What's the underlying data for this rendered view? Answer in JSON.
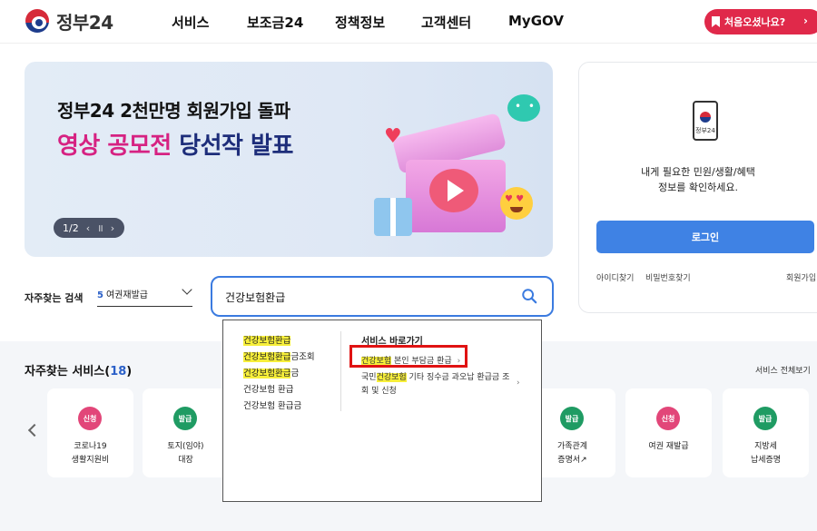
{
  "header": {
    "logo_text": "정부24",
    "nav": [
      "서비스",
      "보조금24",
      "정책정보",
      "고객센터",
      "MyGOV"
    ],
    "cta_label": "처음오셨나요?",
    "cta_arrow": "›"
  },
  "banner": {
    "line1": "정부24  2천만명 회원가입 돌파",
    "line2_pink": "영상 공모전",
    "line2_navy": "당선작 발표",
    "pager_text": "1/2",
    "pager_prev": "‹",
    "pager_pause": "॥",
    "pager_next": "›"
  },
  "login": {
    "phone_label": "정부24",
    "desc_line1": "내게 필요한 민원/생활/혜택",
    "desc_line2": "정보를 확인하세요.",
    "button": "로그인",
    "link_id": "아이디찾기",
    "link_pw": "비밀번호찾기",
    "link_join": "회원가입"
  },
  "search": {
    "freq_label": "자주찾는 검색",
    "freq_num": "5",
    "freq_value": "여권재발급",
    "query": "건강보험환급"
  },
  "autocomplete": {
    "suggestions": [
      {
        "hl": "건강보험환급",
        "rest": ""
      },
      {
        "hl": "건강보험환급",
        "rest": "금조회"
      },
      {
        "hl": "건강보험환급",
        "rest": "금"
      },
      {
        "hl": "",
        "rest": "건강보험 환급"
      },
      {
        "hl": "",
        "rest": "건강보험 환급금"
      }
    ],
    "shortcut_title": "서비스 바로가기",
    "shortcut1_hl": "건강보험",
    "shortcut1_rest": " 본인 부담금 환급",
    "shortcut1_chev": "›",
    "shortcut2_pre": "국민",
    "shortcut2_hl": "건강보험",
    "shortcut2_rest": " 기타 징수금 과오납 환급금 조",
    "shortcut2_line2": "회 및 신청",
    "shortcut2_chev": "›"
  },
  "services": {
    "title": "자주찾는 서비스(",
    "count": "18",
    "title_end": ")",
    "all_link": "서비스 전체보기",
    "cards": [
      {
        "badge": "신청",
        "type": "apply",
        "line1": "코로나19",
        "line2": "생활지원비"
      },
      {
        "badge": "발급",
        "type": "issue",
        "line1": "토지(임야)",
        "line2": "대장"
      },
      {
        "badge": "발급",
        "type": "issue",
        "line1": "가족관계",
        "line2": "증명서↗"
      },
      {
        "badge": "신청",
        "type": "apply",
        "line1": "여권 재발급",
        "line2": ""
      },
      {
        "badge": "발급",
        "type": "issue",
        "line1": "지방세",
        "line2": "납세증명"
      }
    ]
  },
  "colors": {
    "brand_red": "#e0294a",
    "login_blue": "#3f82e4",
    "search_border": "#3b7be0",
    "highlight": "#f7ef3a",
    "annotation_red": "#e01212"
  }
}
